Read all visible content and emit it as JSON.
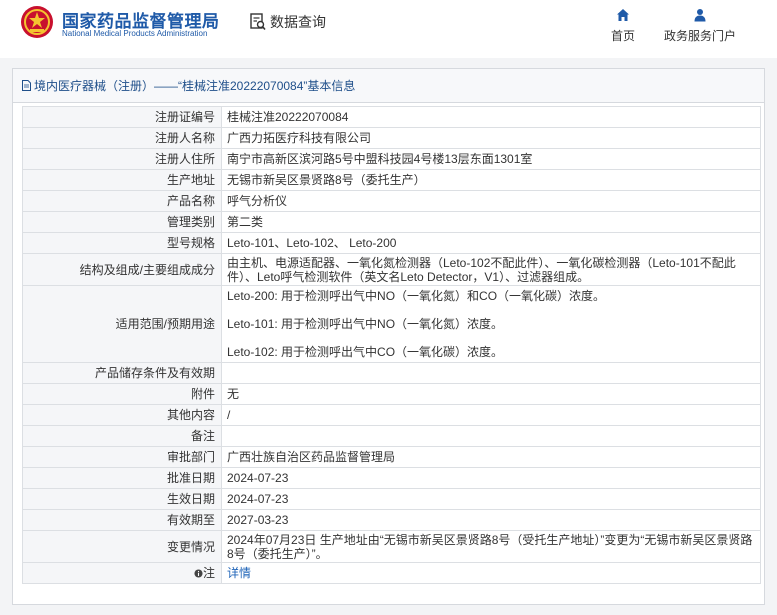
{
  "header": {
    "brand_cn": "国家药品监督管理局",
    "brand_en": "National Medical Products Administration",
    "query_label": "数据查询",
    "nav": [
      {
        "label": "首页",
        "icon": "home-icon"
      },
      {
        "label": "政务服务门户",
        "icon": "user-icon"
      }
    ]
  },
  "colors": {
    "brand": "#1f5aa8",
    "link": "#1f64b8",
    "label_bg": "#f5f6f8",
    "border": "#dcdfe3"
  },
  "panel": {
    "title": "境内医疗器械（注册）——“桂械注准20222070084”基本信息"
  },
  "record": {
    "reg_no": {
      "label": "注册证编号",
      "value": "桂械注准20222070084"
    },
    "registrant": {
      "label": "注册人名称",
      "value": "广西力拓医疗科技有限公司"
    },
    "address": {
      "label": "注册人住所",
      "value": "南宁市高新区滨河路5号中盟科技园4号楼13层东面1301室"
    },
    "production": {
      "label": "生产地址",
      "value": "无锡市新吴区景贤路8号（委托生产）"
    },
    "product_name": {
      "label": "产品名称",
      "value": "呼气分析仪"
    },
    "category": {
      "label": "管理类别",
      "value": "第二类"
    },
    "model": {
      "label": "型号规格",
      "value": "Leto-101、Leto-102、 Leto-200"
    },
    "structure": {
      "label": "结构及组成/主要组成成分",
      "value": "由主机、电源适配器、一氧化氮检测器（Leto-102不配此件）、一氧化碳检测器（Leto-101不配此件）、Leto呼气检测软件（英文名Leto Detector，V1）、过滤器组成。"
    },
    "usage": {
      "label": "适用范围/预期用途",
      "line1": "Leto-200: 用于检测呼出气中NO（一氧化氮）和CO（一氧化碳）浓度。",
      "line2": "Leto-101: 用于检测呼出气中NO（一氧化氮）浓度。",
      "line3": "Leto-102: 用于检测呼出气中CO（一氧化碳）浓度。"
    },
    "storage": {
      "label": "产品储存条件及有效期",
      "value": ""
    },
    "attachment": {
      "label": "附件",
      "value": "无"
    },
    "other": {
      "label": "其他内容",
      "value": "/"
    },
    "remarks": {
      "label": "备注",
      "value": ""
    },
    "approval_dept": {
      "label": "审批部门",
      "value": "广西壮族自治区药品监督管理局"
    },
    "approval_date": {
      "label": "批准日期",
      "value": "2024-07-23"
    },
    "effective_date": {
      "label": "生效日期",
      "value": "2024-07-23"
    },
    "valid_until": {
      "label": "有效期至",
      "value": "2027-03-23"
    },
    "changes": {
      "label": "变更情况",
      "value": "2024年07月23日 生产地址由“无锡市新吴区景贤路8号（受托生产地址）”变更为“无锡市新吴区景贤路8号（委托生产）”。"
    },
    "note": {
      "label": "注",
      "link": "详情",
      "icon": "info-icon"
    }
  }
}
